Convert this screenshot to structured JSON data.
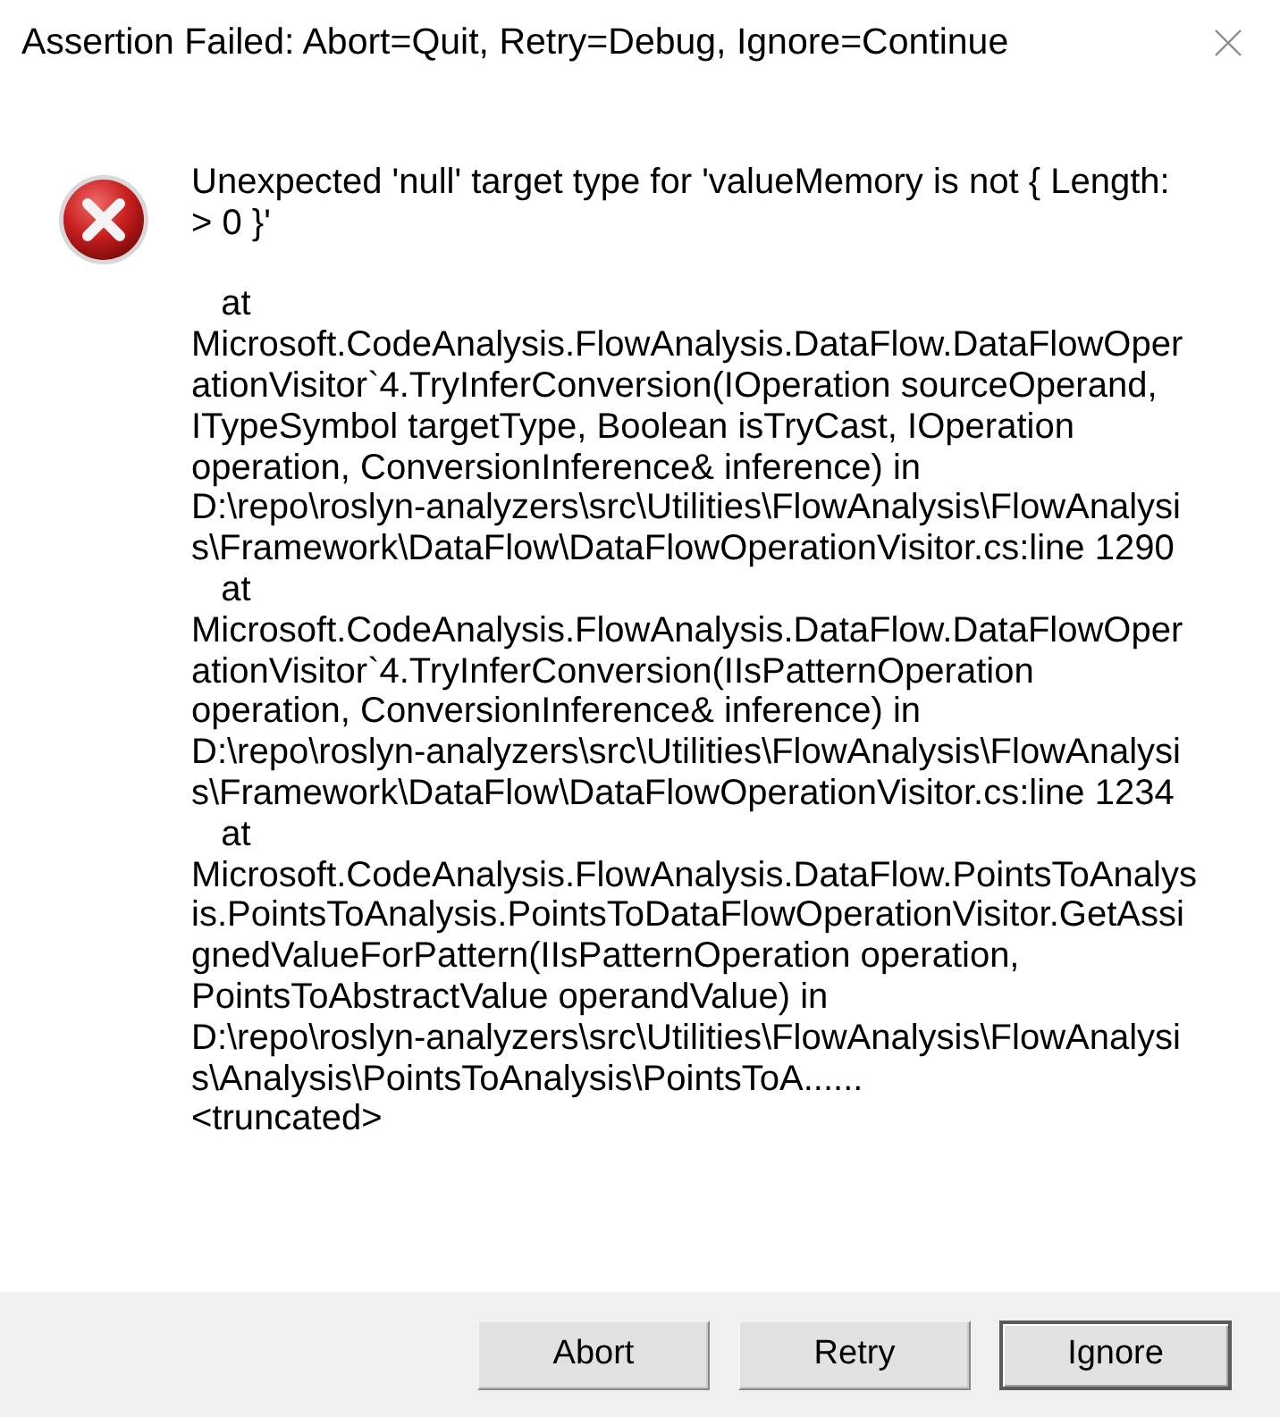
{
  "window": {
    "title": "Assertion Failed: Abort=Quit, Retry=Debug, Ignore=Continue"
  },
  "message": {
    "kind": "error",
    "text": "Unexpected 'null' target type for 'valueMemory is not { Length:\n> 0 }'\n\n   at\nMicrosoft.CodeAnalysis.FlowAnalysis.DataFlow.DataFlowOper\nationVisitor`4.TryInferConversion(IOperation sourceOperand,\nITypeSymbol targetType, Boolean isTryCast, IOperation\noperation, ConversionInference& inference) in\nD:\\repo\\roslyn-analyzers\\src\\Utilities\\FlowAnalysis\\FlowAnalysi\ns\\Framework\\DataFlow\\DataFlowOperationVisitor.cs:line 1290\n   at\nMicrosoft.CodeAnalysis.FlowAnalysis.DataFlow.DataFlowOper\nationVisitor`4.TryInferConversion(IIsPatternOperation\noperation, ConversionInference& inference) in\nD:\\repo\\roslyn-analyzers\\src\\Utilities\\FlowAnalysis\\FlowAnalysi\ns\\Framework\\DataFlow\\DataFlowOperationVisitor.cs:line 1234\n   at\nMicrosoft.CodeAnalysis.FlowAnalysis.DataFlow.PointsToAnalys\nis.PointsToAnalysis.PointsToDataFlowOperationVisitor.GetAssi\ngnedValueForPattern(IIsPatternOperation operation,\nPointsToAbstractValue operandValue) in\nD:\\repo\\roslyn-analyzers\\src\\Utilities\\FlowAnalysis\\FlowAnalysi\ns\\Analysis\\PointsToAnalysis\\PointsToA......\n<truncated>"
  },
  "buttons": [
    {
      "label": "Abort",
      "default": false
    },
    {
      "label": "Retry",
      "default": false
    },
    {
      "label": "Ignore",
      "default": true
    }
  ]
}
